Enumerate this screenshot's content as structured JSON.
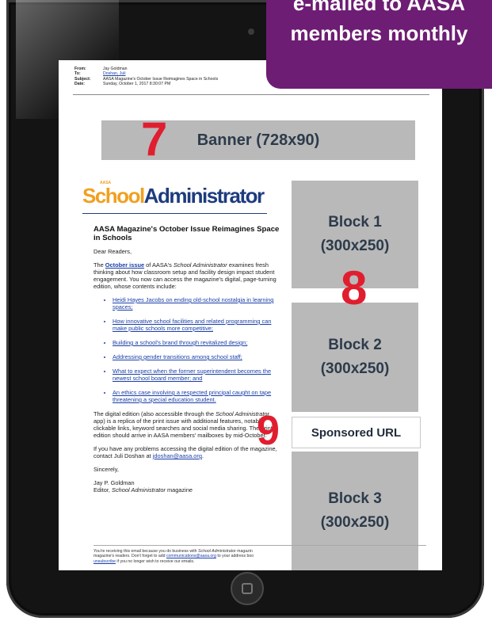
{
  "email_header": {
    "from_label": "From:",
    "from_value": "Jay Goldman",
    "to_label": "To:",
    "to_value": "Doshan, Juli",
    "subject_label": "Subject:",
    "subject_value": "AASA Magazine's October Issue Reimagines Space in Schools",
    "date_label": "Date:",
    "date_value": "Sunday, October 1, 2017 8:30:07 PM"
  },
  "callout": {
    "line1": "e-mailed to AASA",
    "line2": "members monthly"
  },
  "ad_slots": {
    "banner": "Banner (728x90)",
    "block1_line1": "Block 1",
    "block1_line2": "(300x250)",
    "block2_line1": "Block 2",
    "block2_line2": "(300x250)",
    "sponsored": "Sponsored URL",
    "block3_line1": "Block 3",
    "block3_line2": "(300x250)"
  },
  "markers": {
    "m7": "7",
    "m8": "8",
    "m9": "9"
  },
  "logo": {
    "tag": "AASA",
    "part1": "School",
    "part2": "Administrator"
  },
  "article": {
    "headline": "AASA Magazine's October Issue Reimagines Space in Schools",
    "greeting": "Dear Readers,",
    "intro_pre": "The ",
    "intro_link": "October issue",
    "intro_mid": " of AASA's ",
    "intro_italic": "School Administrator",
    "intro_post": " examines fresh thinking about how classroom setup and facility design impact student engagement. You now can access the magazine's digital, page-turning edition, whose contents include:",
    "bullets": [
      "Heidi Hayes Jacobs on ending old-school nostalgia in learning spaces;",
      "How innovative school facilities and related programming can make public schools more competitive;",
      "Building a school's brand through revitalized design;",
      "Addressing gender transitions among school staff;",
      "What to expect when the former superintendent becomes the newest school board member; and",
      "An ethics case involving a respected principal caught on tape threatening a special education student."
    ],
    "digital_pre": "The digital edition (also accessible through the ",
    "digital_italic": "School Administrator",
    "digital_post": " app) is a replica of the print issue with additional features, notably clickable links, keyword searches and social media sharing. The print edition should arrive in AASA members' mailboxes by mid-October.",
    "problems_pre": "If you have any problems accessing the digital edition of the magazine, contact Juli Doshan at ",
    "problems_link": "jdoshan@aasa.org",
    "problems_post": ".",
    "signoff": "Sincerely,",
    "sig_name": "Jay P. Goldman",
    "sig_title_pre": "Editor, ",
    "sig_title_italic": "School Administrator",
    "sig_title_post": " magazine"
  },
  "footer": {
    "line1_pre": "You're receiving this email because you do business with ",
    "line1_italic": "School Administrator",
    "line1_post": " magazin",
    "line2_pre": "magazine's readers. Don't forget to add ",
    "line2_link": "communications@aasa.org",
    "line2_post": " to your address boo",
    "line3_link": "unsubscribe",
    "line3_post": " if you no longer wish to receive our emails."
  },
  "colors": {
    "accent_purple": "#6d1d73",
    "marker_red": "#e01e2f",
    "ad_gray": "#b9b9b9",
    "link_blue": "#1a3ea8"
  }
}
